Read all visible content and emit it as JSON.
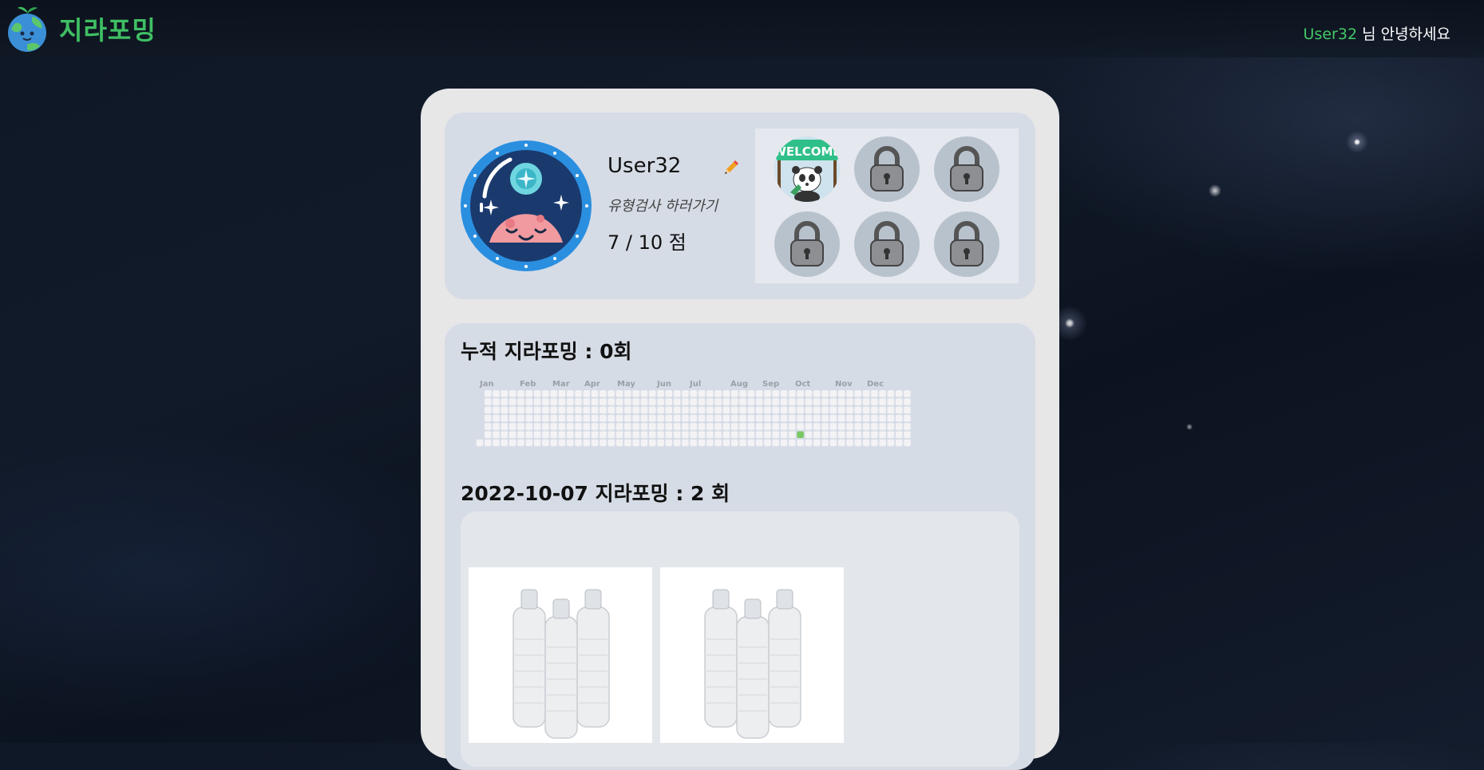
{
  "header": {
    "logo_text": "지라포밍",
    "greeting_user": "User32",
    "greeting_suffix": " 님 안녕하세요"
  },
  "profile": {
    "username": "User32",
    "survey_link": "유형검사 하러가기",
    "score": "7 / 10 점",
    "badges": [
      {
        "icon": "welcome-panda-badge",
        "text": "WELCOME",
        "locked": false
      },
      {
        "icon": "lock-icon",
        "locked": true
      },
      {
        "icon": "lock-icon",
        "locked": true
      },
      {
        "icon": "lock-icon",
        "locked": true
      },
      {
        "icon": "lock-icon",
        "locked": true
      },
      {
        "icon": "lock-icon",
        "locked": true
      }
    ]
  },
  "activity": {
    "total_title": "누적 지라포밍 : 0회",
    "months": [
      "Jan",
      "Feb",
      "Mar",
      "Apr",
      "May",
      "Jun",
      "Jul",
      "Aug",
      "Sep",
      "Oct",
      "Nov",
      "Dec"
    ],
    "daily_title": "2022-10-07 지라포밍 : 2 회",
    "active_day_color": "#7ac863"
  },
  "photos": [
    {
      "icon": "water-bottles-photo"
    },
    {
      "icon": "water-bottles-photo"
    }
  ],
  "colors": {
    "brand_green": "#3fbf63",
    "panel": "#d6dce6",
    "card": "#e7e7e8"
  }
}
